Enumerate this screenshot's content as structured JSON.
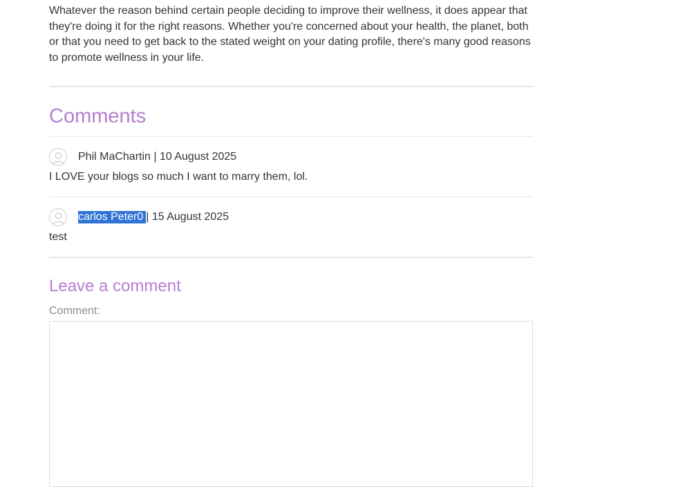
{
  "article": {
    "closing_paragraph": "Whatever the reason behind certain people deciding to improve their wellness, it does appear that they're doing it for the right reasons. Whether you're concerned about your health, the planet, both or that you need to get back to the stated weight on your dating profile, there's many good reasons to promote wellness in your life."
  },
  "comments": {
    "title": "Comments",
    "items": [
      {
        "author": "Phil MaChartin",
        "separator": " | ",
        "date": "10 August 2025",
        "body": "I LOVE your blogs so much I want to marry them, lol."
      },
      {
        "author": "carlos Peter0",
        "separator": "| ",
        "date": "15 August 2025",
        "body": "test"
      }
    ]
  },
  "leave_comment": {
    "title": "Leave a comment",
    "comment_label": "Comment:",
    "comment_value": ""
  },
  "colors": {
    "heading": "#b77ecf",
    "selection_highlight": "#2f73d6",
    "text": "#333333"
  },
  "icons": {
    "avatar": "user-avatar-icon"
  }
}
